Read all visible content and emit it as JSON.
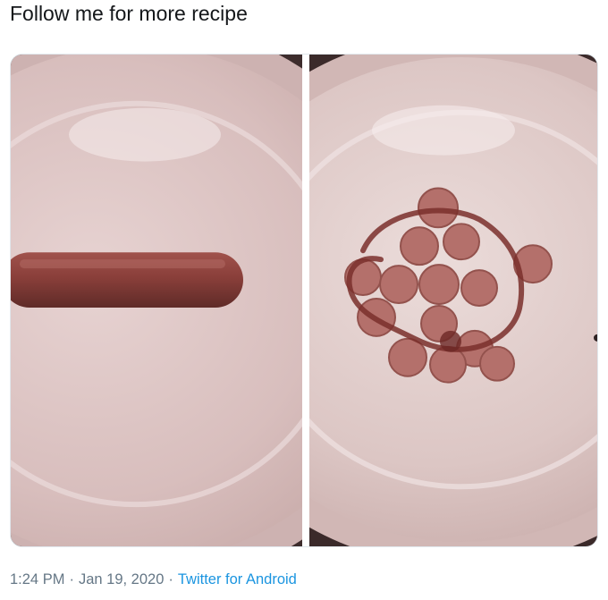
{
  "tweet": {
    "text": "Follow me for more recipe"
  },
  "media": {
    "photos": [
      {
        "name": "sausage-plate-photo"
      },
      {
        "name": "sliced-sausage-face-photo"
      }
    ]
  },
  "meta": {
    "time": "1:24 PM",
    "separator": "·",
    "date": "Jan 19, 2020",
    "source": "Twitter for Android"
  }
}
